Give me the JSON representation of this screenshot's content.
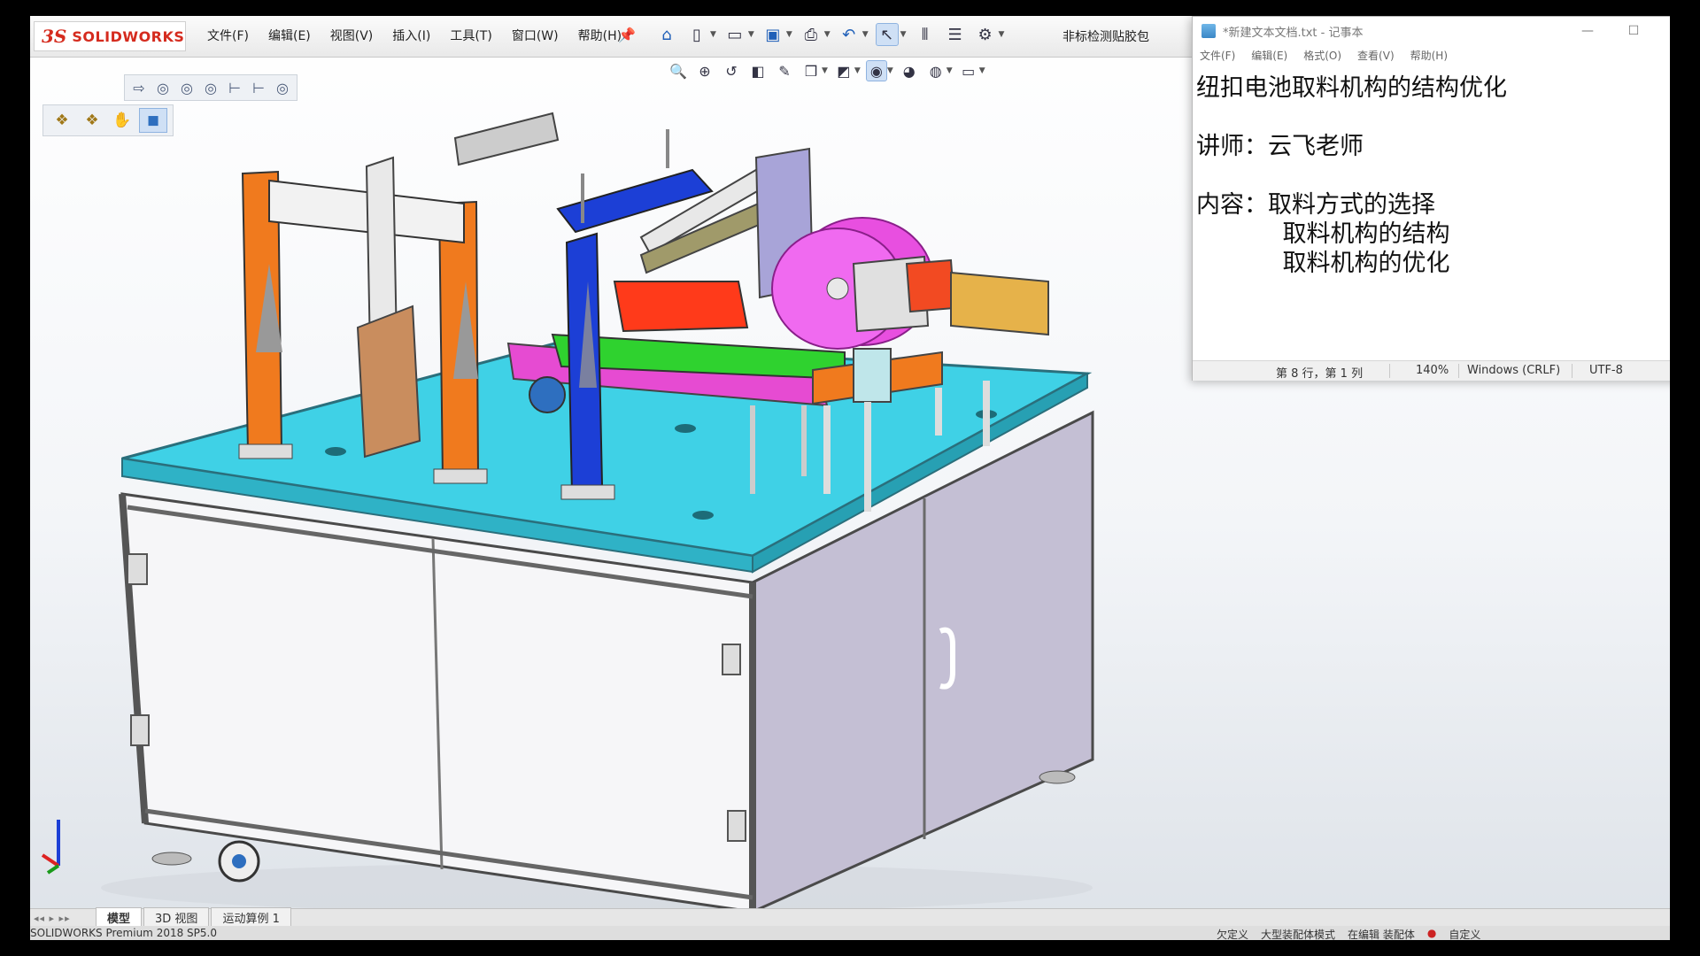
{
  "solidworks": {
    "logo_mark": "3S",
    "logo_text": "SOLIDWORKS",
    "menu": [
      "文件(F)",
      "编辑(E)",
      "视图(V)",
      "插入(I)",
      "工具(T)",
      "窗口(W)",
      "帮助(H)"
    ],
    "doc_title": "非标检测贴胶包",
    "tabs": [
      "模型",
      "3D 视图",
      "运动算例 1"
    ],
    "tab_nav": "◂◂ ▸ ▸▸",
    "status_left": "SOLIDWORKS Premium 2018 SP5.0",
    "status_right": [
      "欠定义",
      "大型装配体模式",
      "在编辑 装配体",
      "自定义"
    ]
  },
  "notepad": {
    "title": "*新建文本文档.txt - 记事本",
    "menu": [
      "文件(F)",
      "编辑(E)",
      "格式(O)",
      "查看(V)",
      "帮助(H)"
    ],
    "lines": [
      "纽扣电池取料机构的结构优化",
      "",
      "讲师：云飞老师",
      "",
      "内容：取料方式的选择",
      "      取料机构的结构",
      "      取料机构的优化"
    ],
    "status": {
      "position": "第 8 行，第 1 列",
      "zoom": "140%",
      "line_ending": "Windows (CRLF)",
      "encoding": "UTF-8"
    }
  },
  "icons": {
    "toolbar": [
      "home-icon",
      "new-document-icon",
      "open-folder-icon",
      "save-icon",
      "print-icon",
      "undo-icon",
      "select-pointer-icon",
      "traffic-light-icon",
      "file-properties-icon",
      "options-gear-icon"
    ],
    "view_toolbar": [
      "zoom-to-fit-icon",
      "zoom-area-icon",
      "previous-view-icon",
      "section-view-icon",
      "dynamic-annotation-icon",
      "view-orientation-icon",
      "display-style-icon",
      "hide-show-icon",
      "edit-appearance-icon",
      "apply-scene-icon",
      "view-settings-icon"
    ]
  },
  "colors": {
    "table_top": "#3fd1e6",
    "orange_frame": "#f07a1e",
    "blue_part": "#1c3fd6",
    "magenta_rail": "#e64bd2",
    "green_belt": "#2fd22f",
    "red_block": "#ff3a1a",
    "cabinet_side": "#c4bfd4",
    "accent": "#d52b1e"
  }
}
